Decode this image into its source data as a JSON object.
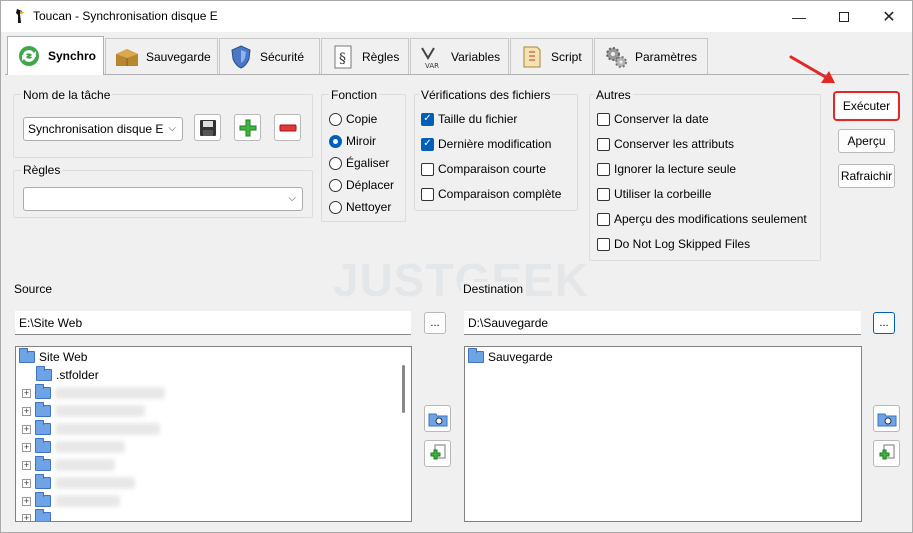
{
  "window": {
    "title": "Toucan - Synchronisation disque E"
  },
  "tabs": [
    {
      "label": "Synchro",
      "icon": "sync-icon"
    },
    {
      "label": "Sauvegarde",
      "icon": "backup-box-icon"
    },
    {
      "label": "Sécurité",
      "icon": "shield-icon"
    },
    {
      "label": "Règles",
      "icon": "rules-document-icon"
    },
    {
      "label": "Variables",
      "icon": "variables-icon"
    },
    {
      "label": "Script",
      "icon": "script-icon"
    },
    {
      "label": "Paramètres",
      "icon": "settings-gears-icon"
    }
  ],
  "task": {
    "label": "Nom de la tâche",
    "value": "Synchronisation disque E"
  },
  "rules": {
    "label": "Règles",
    "value": ""
  },
  "fonction": {
    "label": "Fonction",
    "options": [
      "Copie",
      "Miroir",
      "Égaliser",
      "Déplacer",
      "Nettoyer"
    ],
    "selected": "Miroir"
  },
  "verifications": {
    "label": "Vérifications des fichiers",
    "items": [
      {
        "label": "Taille du fichier",
        "checked": true
      },
      {
        "label": "Dernière modification",
        "checked": true
      },
      {
        "label": "Comparaison courte",
        "checked": false
      },
      {
        "label": "Comparaison complète",
        "checked": false
      }
    ]
  },
  "autres": {
    "label": "Autres",
    "items": [
      {
        "label": "Conserver la date",
        "checked": false
      },
      {
        "label": "Conserver les attributs",
        "checked": false
      },
      {
        "label": "Ignorer la lecture seule",
        "checked": false
      },
      {
        "label": "Utiliser la corbeille",
        "checked": false
      },
      {
        "label": "Aperçu des modifications seulement",
        "checked": false
      },
      {
        "label": "Do Not Log Skipped Files",
        "checked": false
      }
    ]
  },
  "actions": {
    "execute": "Exécuter",
    "preview": "Aperçu",
    "refresh": "Rafraichir"
  },
  "source": {
    "label": "Source",
    "path": "E:\\Site Web",
    "browse": "...",
    "root": "Site Web",
    "children": [
      ".stfolder"
    ]
  },
  "destination": {
    "label": "Destination",
    "path": "D:\\Sauvegarde",
    "browse": "...",
    "root": "Sauvegarde"
  },
  "watermark": "JUSTGEEK",
  "colors": {
    "accent": "#005fb8",
    "highlight": "#e32626",
    "folder": "#6ea4e6"
  }
}
